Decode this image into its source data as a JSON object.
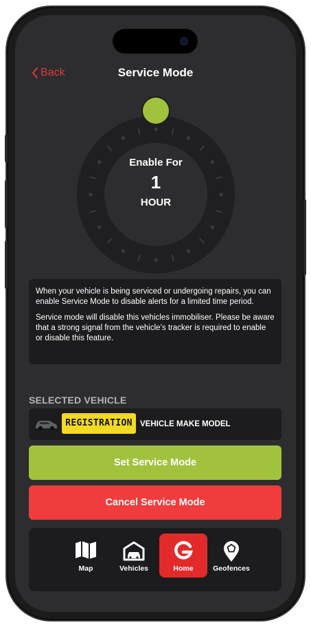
{
  "header": {
    "back_label": "Back",
    "title": "Service Mode"
  },
  "dial": {
    "line1": "Enable For",
    "value": "1",
    "unit": "HOUR"
  },
  "info": {
    "paragraph1": "When your vehicle is being serviced or undergoing repairs, you can enable Service Mode to disable alerts for a limited time period.",
    "paragraph2": "Service mode will disable this vehicles immobiliser. Please be aware that a strong signal from the vehicle’s tracker is required to enable or disable this feature."
  },
  "selected_vehicle": {
    "label": "SELECTED VEHICLE",
    "registration": "REGISTRATION",
    "make_model": "VEHICLE MAKE MODEL"
  },
  "actions": {
    "set_label": "Set Service Mode",
    "cancel_label": "Cancel Service Mode"
  },
  "tabs": [
    {
      "label": "Map",
      "icon": "map-icon"
    },
    {
      "label": "Vehicles",
      "icon": "garage-car-icon"
    },
    {
      "label": "Home",
      "icon": "brand-g-icon",
      "active": true
    },
    {
      "label": "Geofences",
      "icon": "geofence-pin-icon"
    }
  ],
  "colors": {
    "accent_green": "#a1c23d",
    "accent_red": "#f03c3c",
    "back_red": "#e03a3a",
    "plate_yellow": "#f3da23",
    "screen_bg": "#2d2d2f",
    "card_bg": "#1c1c1e"
  }
}
